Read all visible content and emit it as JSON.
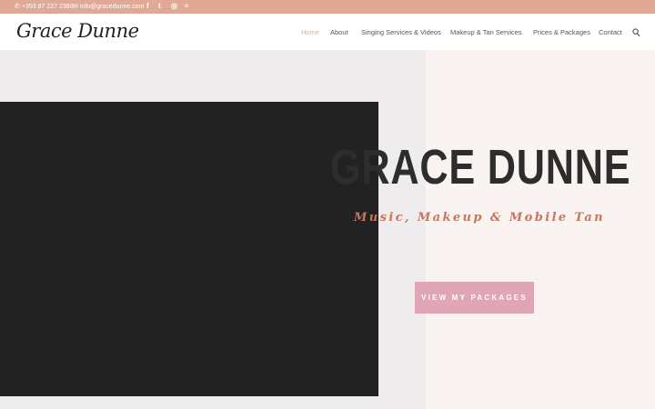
{
  "topbar": {
    "phone": "+353 87 227 2380",
    "email": "info@gracedunne.com",
    "social": [
      {
        "name": "facebook-icon",
        "glyph": "f"
      },
      {
        "name": "twitter-icon",
        "glyph": "t"
      },
      {
        "name": "instagram-icon",
        "glyph": "◎"
      },
      {
        "name": "rss-icon",
        "glyph": "≈"
      }
    ],
    "colors": {
      "background": "#dfa995"
    }
  },
  "header": {
    "logo": "Grace Dunne",
    "nav": [
      {
        "label": "Home",
        "active": true
      },
      {
        "label": "About"
      },
      {
        "label": "Singing Services & Videos"
      },
      {
        "label": "Makeup & Tan Services"
      },
      {
        "label": "Prices & Packages"
      },
      {
        "label": "Contact"
      }
    ],
    "search_icon": "search-icon"
  },
  "hero": {
    "title": "GRACE DUNNE",
    "subtitle": "Music, Makeup & Mobile Tan",
    "cta_label": "VIEW MY PACKAGES",
    "colors": {
      "cta": "#e0a6b5",
      "accent": "#c7755c",
      "dark": "#222222"
    }
  }
}
